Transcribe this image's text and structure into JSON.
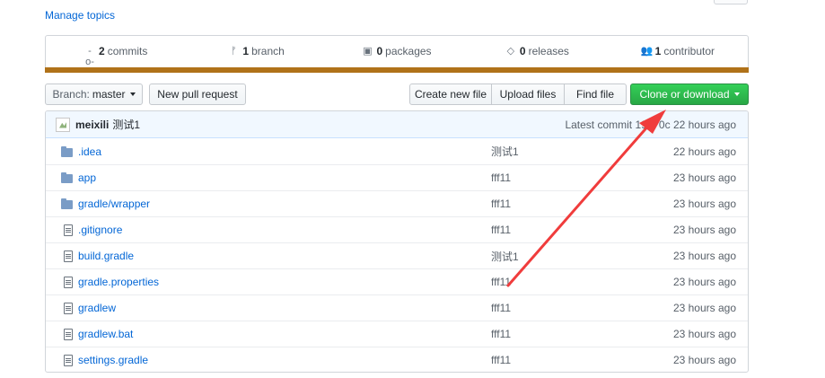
{
  "header": {
    "manage_topics": "Manage topics"
  },
  "numbers_summary": {
    "commits": {
      "count": "2",
      "label": "commits",
      "icon": "commit-icon"
    },
    "branches": {
      "count": "1",
      "label": "branch",
      "icon": "branch-icon"
    },
    "packages": {
      "count": "0",
      "label": "packages",
      "icon": "package-icon"
    },
    "releases": {
      "count": "0",
      "label": "releases",
      "icon": "tag-icon"
    },
    "contributors": {
      "count": "1",
      "label": "contributor",
      "icon": "people-icon"
    },
    "language_color": "#b07219"
  },
  "toolbar": {
    "branch_label": "Branch:",
    "branch_value": "master",
    "new_pull_request": "New pull request",
    "create_new_file": "Create new file",
    "upload_files": "Upload files",
    "find_file": "Find file",
    "clone_or_download": "Clone or download"
  },
  "commit_tease": {
    "author": "meixili",
    "message": "测试1",
    "latest_commit": "Latest commit 19ff70c 22 hours ago"
  },
  "files": [
    {
      "type": "folder",
      "name": ".idea",
      "message": "测试1",
      "age": "22 hours ago"
    },
    {
      "type": "folder",
      "name": "app",
      "message": "fff11",
      "age": "23 hours ago"
    },
    {
      "type": "folder",
      "name": "gradle/wrapper",
      "message": "fff11",
      "age": "23 hours ago"
    },
    {
      "type": "file",
      "name": ".gitignore",
      "message": "fff11",
      "age": "23 hours ago"
    },
    {
      "type": "file",
      "name": "build.gradle",
      "message": "测试1",
      "age": "23 hours ago"
    },
    {
      "type": "file",
      "name": "gradle.properties",
      "message": "fff11",
      "age": "23 hours ago"
    },
    {
      "type": "file",
      "name": "gradlew",
      "message": "fff11",
      "age": "23 hours ago"
    },
    {
      "type": "file",
      "name": "gradlew.bat",
      "message": "fff11",
      "age": "23 hours ago"
    },
    {
      "type": "file",
      "name": "settings.gradle",
      "message": "fff11",
      "age": "23 hours ago"
    }
  ],
  "annotation": {
    "arrow_color": "#f03c3c"
  }
}
